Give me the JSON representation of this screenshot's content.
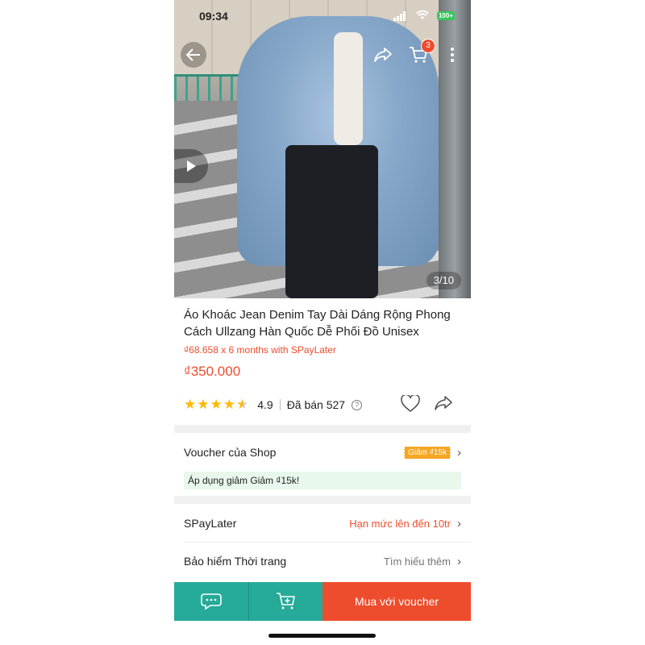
{
  "status_bar": {
    "time": "09:34",
    "battery": "100+"
  },
  "gallery": {
    "counter": "3/10"
  },
  "header": {
    "cart_count": "3"
  },
  "product": {
    "title": "Áo Khoác Jean Denim Tay Dài Dáng Rộng Phong Cách Ullzang Hàn Quốc Dễ Phối Đồ Unisex",
    "installment": "₫68.658 x 6 months with SPayLater",
    "price": "₫350.000",
    "rating": "4.9",
    "rating_stars": 4.5,
    "sold": "Đã bán 527"
  },
  "voucher": {
    "label": "Voucher của Shop",
    "tag": "Giảm ₫15k",
    "applied_text": "Áp dụng giảm Giảm ₫15k!"
  },
  "spaylater": {
    "label": "SPayLater",
    "value": "Hạn mức lên đến 10tr"
  },
  "insurance": {
    "label": "Bảo hiểm Thời trang",
    "value": "Tìm hiểu thêm"
  },
  "bottom_bar": {
    "buy_label": "Mua với voucher"
  },
  "colors": {
    "accent": "#ee4d2d",
    "teal": "#26aa99",
    "star": "#ffb800"
  }
}
